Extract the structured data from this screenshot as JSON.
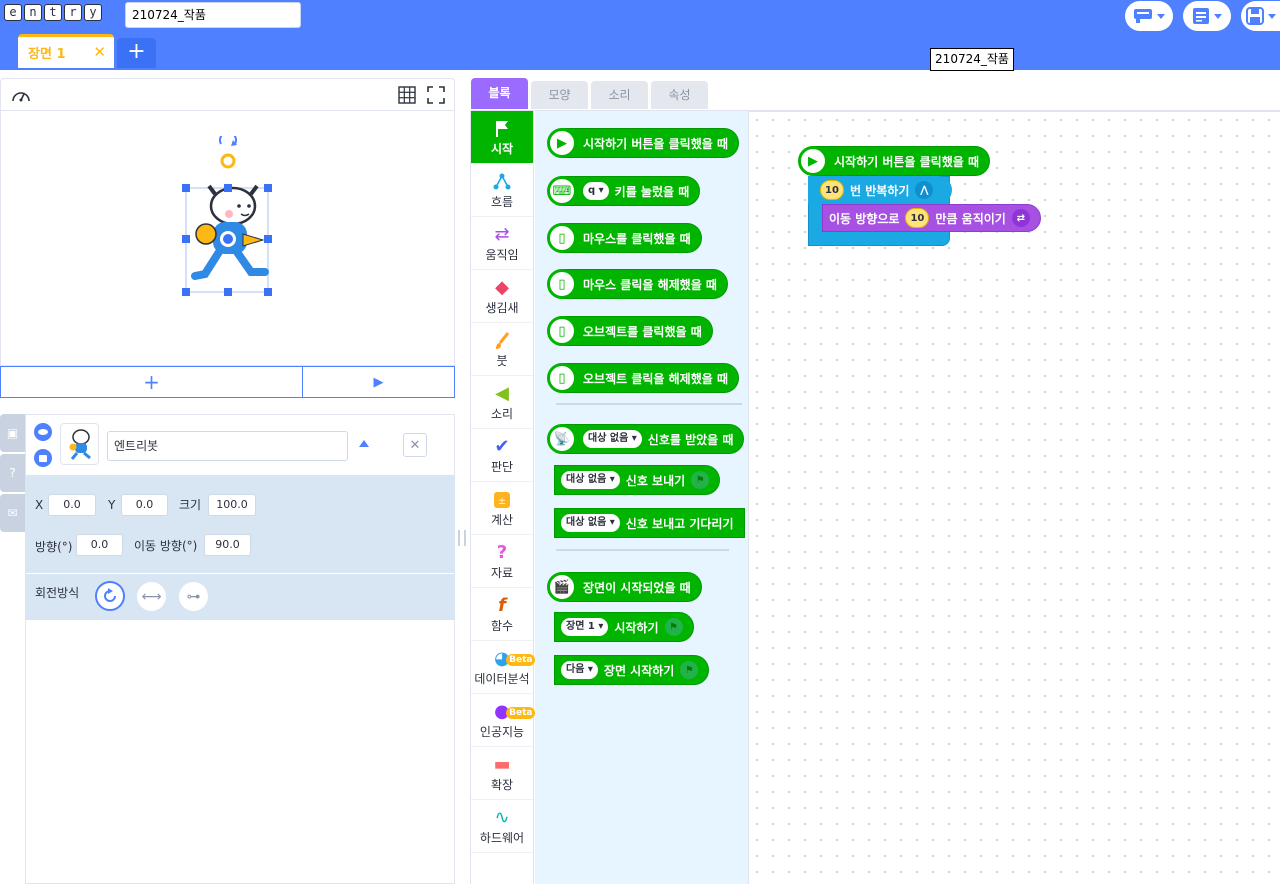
{
  "topbar": {
    "logo_letters": [
      "e",
      "n",
      "t",
      "r",
      "y"
    ],
    "project_name": "210724_작품",
    "tooltip": "210724_작품",
    "buttons": [
      "comment-icon",
      "list-icon",
      "save-icon"
    ]
  },
  "scene": {
    "tab_label": "장면 1",
    "close": "✕",
    "add": "+"
  },
  "stage": {
    "add_label": "+",
    "play_label": "▶"
  },
  "object": {
    "name": "엔트리봇",
    "x_label": "X",
    "x": "0.0",
    "y_label": "Y",
    "y": "0.0",
    "size_label": "크기",
    "size": "100.0",
    "dir_label": "방향(°)",
    "dir": "0.0",
    "move_dir_label": "이동 방향(°)",
    "move_dir": "90.0",
    "rotation_label": "회전방식"
  },
  "block_tabs": [
    "블록",
    "모양",
    "소리",
    "속성"
  ],
  "categories": [
    {
      "label": "시작",
      "icon": "flag-icon"
    },
    {
      "label": "흐름",
      "icon": "flow-icon"
    },
    {
      "label": "움직임",
      "icon": "move-icon"
    },
    {
      "label": "생김새",
      "icon": "looks-icon"
    },
    {
      "label": "붓",
      "icon": "brush-icon"
    },
    {
      "label": "소리",
      "icon": "sound-icon"
    },
    {
      "label": "판단",
      "icon": "check-icon"
    },
    {
      "label": "계산",
      "icon": "calc-icon"
    },
    {
      "label": "자료",
      "icon": "data-icon"
    },
    {
      "label": "함수",
      "icon": "function-icon"
    },
    {
      "label": "데이터분석",
      "icon": "chart-icon",
      "badge": "Beta"
    },
    {
      "label": "인공지능",
      "icon": "ai-icon",
      "badge": "Beta"
    },
    {
      "label": "확장",
      "icon": "extension-icon"
    },
    {
      "label": "하드웨어",
      "icon": "hardware-icon"
    }
  ],
  "palette": {
    "start_click": "시작하기 버튼을 클릭했을 때",
    "key_dd": "q ▾",
    "key_text": "키를 눌렀을 때",
    "mouse_click": "마우스를 클릭했을 때",
    "mouse_release": "마우스 클릭을 해제했을 때",
    "obj_click": "오브젝트를 클릭했을 때",
    "obj_release": "오브젝트 클릭을 해제했을 때",
    "signal_dd": "대상 없음 ▾",
    "signal_received": "신호를 받았을 때",
    "signal_send": "신호 보내기",
    "signal_send_wait": "신호 보내고 기다리기",
    "scene_started": "장면이 시작되었을 때",
    "scene_dd": "장면 1 ▾",
    "scene_start": "시작하기",
    "next_dd": "다음 ▾",
    "next_scene": "장면 시작하기"
  },
  "script": {
    "hat": "시작하기 버튼을 클릭했을 때",
    "repeat_num": "10",
    "repeat_text": "번 반복하기",
    "move_pre": "이동 방향으로",
    "move_num": "10",
    "move_post": "만큼 움직이기"
  }
}
